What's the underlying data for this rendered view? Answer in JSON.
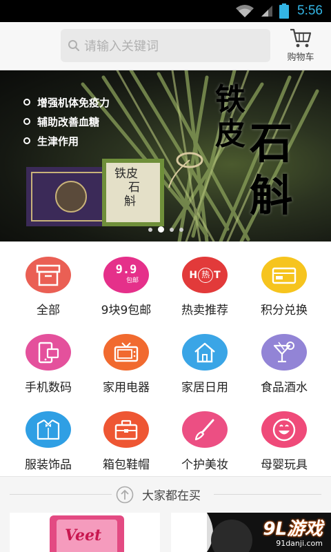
{
  "status_bar": {
    "time": "5:56"
  },
  "header": {
    "search": {
      "placeholder": "请输入关键词"
    },
    "cart": {
      "label": "购物车"
    }
  },
  "banner": {
    "bullets": [
      "增强机体免疫力",
      "辅助改善血糖",
      "生津作用"
    ],
    "title_small": [
      "铁",
      "皮"
    ],
    "title_large": [
      "石",
      "斛"
    ],
    "box_label": [
      "铁",
      "皮",
      "石",
      "斛"
    ],
    "page_count": 4,
    "active_page": 1
  },
  "categories": [
    {
      "label": "全部",
      "icon": "box-icon",
      "color": "#ea5f54"
    },
    {
      "label": "9块9包邮",
      "icon": "nine-nine-icon",
      "color": "#e5308a",
      "icon_text": "9.9",
      "icon_sub": "包邮"
    },
    {
      "label": "热卖推荐",
      "icon": "hot-icon",
      "color": "#e23a3a",
      "icon_text_left": "H",
      "icon_text_mid": "热",
      "icon_text_right": "T"
    },
    {
      "label": "积分兑换",
      "icon": "card-icon",
      "color": "#f6c41e"
    },
    {
      "label": "手机数码",
      "icon": "phone-icon",
      "color": "#e4519c"
    },
    {
      "label": "家用电器",
      "icon": "tv-icon",
      "color": "#f16a2f"
    },
    {
      "label": "家居日用",
      "icon": "home-icon",
      "color": "#3aa5e6"
    },
    {
      "label": "食品酒水",
      "icon": "cocktail-icon",
      "color": "#9284d6"
    },
    {
      "label": "服装饰品",
      "icon": "shirt-icon",
      "color": "#2f9fe4"
    },
    {
      "label": "箱包鞋帽",
      "icon": "bag-icon",
      "color": "#ee5633"
    },
    {
      "label": "个护美妆",
      "icon": "brush-icon",
      "color": "#ec4f83"
    },
    {
      "label": "母婴玩具",
      "icon": "smiley-icon",
      "color": "#ef4a79"
    }
  ],
  "popular": {
    "title": "大家都在买"
  },
  "products": [
    {
      "brand": "Veet"
    }
  ],
  "watermark": {
    "brand": "9L游戏",
    "site": "91danji.com"
  }
}
